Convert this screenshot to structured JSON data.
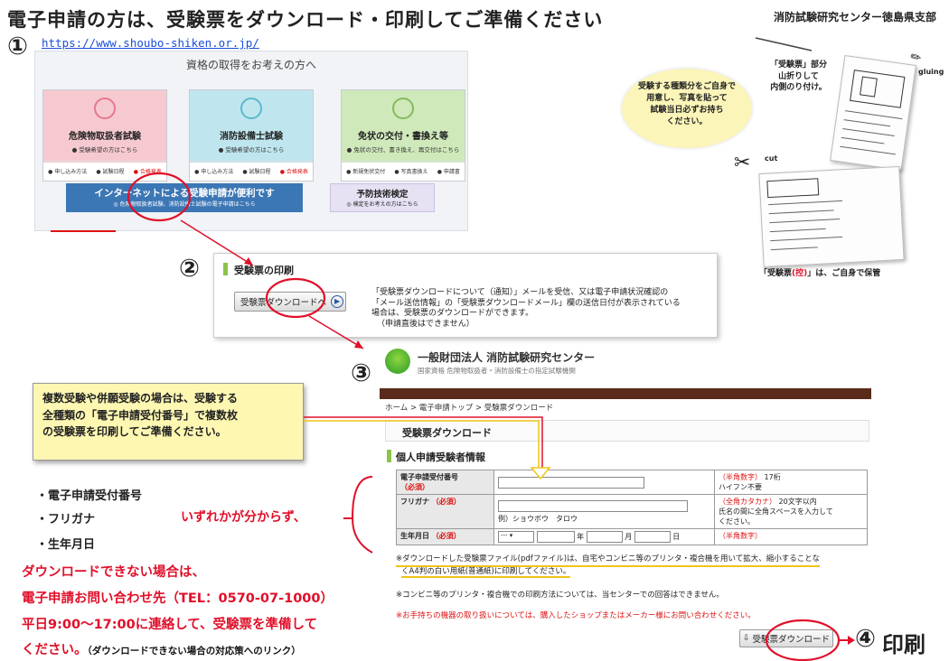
{
  "header": {
    "title": "電子申請の方は、受験票をダウンロード・印刷してご準備ください",
    "org": "消防試験研究センター徳島県支部"
  },
  "steps": {
    "one": "①",
    "two": "②",
    "three": "③",
    "four": "④",
    "print_label": "印刷"
  },
  "step1": {
    "url": "https://www.shoubo-shiken.or.jp/",
    "heading": "資格の取得をお考えの方へ",
    "cards": [
      {
        "title": "危険物取扱者試験",
        "sub": "● 受験希望の方はこちら",
        "links": [
          "● 申し込み方法",
          "● 試験日程",
          "● 合格発表"
        ],
        "color": "#f6c9d0",
        "icon_color": "#e35a7a"
      },
      {
        "title": "消防設備士試験",
        "sub": "● 受験希望の方はこちら",
        "links": [
          "● 申し込み方法",
          "● 試験日程",
          "● 合格発表"
        ],
        "color": "#bfe6ee",
        "icon_color": "#3aa9c4"
      },
      {
        "title": "免状の交付・書換え等",
        "sub": "● 免状の交付、書き換え、再交付はこちら",
        "links": [
          "● 新規免状交付",
          "● 写真書換え",
          "● 申請書"
        ],
        "color": "#cfe9bb",
        "icon_color": "#6aab3c"
      }
    ],
    "internet_title": "インターネットによる受験申請が便利です",
    "internet_sub": "◎ 危険物取扱者試験、消防設備士試験の電子申請はこちら",
    "yobo_title": "予防技術検定",
    "yobo_sub": "◎ 検定をお考えの方はこちら"
  },
  "step2": {
    "title": "受験票の印刷",
    "button": "受験票ダウンロードへ",
    "text": [
      "「受験票ダウンロードについて（通知）」メールを受信、又は電子申請状況確認の",
      "「メール送信情報」の「受験票ダウンロードメール」欄の送信日付が表示されている",
      "場合は、受験票のダウンロードができます。",
      "（申請直後はできません）"
    ]
  },
  "step3": {
    "org_name": "一般財団法人 消防試験研究センター",
    "org_sub": "国家資格 危険物取扱者・消防設備士の指定試験機関",
    "breadcrumb": "ホーム > 電子申請トップ > 受験票ダウンロード",
    "page_title": "受験票ダウンロード",
    "section_title": "個人申請受験者情報",
    "fields": [
      {
        "label": "電子申請受付番号",
        "required": "（必須）",
        "hint_red": "（半角数字）",
        "hint": "17桁",
        "hint2": "ハイフン不要"
      },
      {
        "label": "フリガナ",
        "required": "（必須）",
        "example": "例）ショウボウ　タロウ",
        "hint_red": "（全角カタカナ）",
        "hint": "20文字以内",
        "hint2": "氏名の間に全角スペースを入力して",
        "hint3": "ください。"
      },
      {
        "label": "生年月日",
        "required": "（必須）",
        "select": "---",
        "year": "年",
        "month": "月",
        "day": "日",
        "hint_red": "（半角数字）"
      }
    ],
    "note1_a": "※ダウンロードした受験票ファイル(pdfファイル)は、自宅やコンビニ等のプリンタ・複合機を用いて拡大、縮小することな",
    "note1_b": "くA4判の白い用紙(普通紙)に印刷してください。",
    "note2": "※コンビニ等のプリンタ・複合機での印刷方法については、当センターでの回答はできません。",
    "note3": "※お手持ちの機器の取り扱いについては、購入したショップまたはメーカー様にお問い合わせください。",
    "download_button": "受験票ダウンロード"
  },
  "left_notes": {
    "yellow": [
      "複数受験や併願受験の場合は、受験する",
      "全種類の「電子申請受付番号」で複数枚",
      "の受験票を印刷してご準備ください。"
    ],
    "items": [
      "・電子申請受付番号",
      "・フリガナ",
      "・生年月日"
    ],
    "unknown": "いずれかが分からず、",
    "red_lines": [
      "ダウンロードできない場合は、",
      "電子申請お問い合わせ先（TEL：0570-07-1000）",
      "平日9:00～17:00に連絡して、受験票を準備して",
      "ください。"
    ],
    "link": "（ダウンロードできない場合の対応策へのリンク）"
  },
  "right": {
    "bubble": [
      "受験する種類分をご自身で",
      "用意し、写真を貼って",
      "試験当日必ずお持ち",
      "ください。"
    ],
    "fold_note": [
      "「受験票」部分",
      "山折りして",
      "内側のり付け。"
    ],
    "gluing": "gluing",
    "cut": "cut",
    "stub_a": "「受験票",
    "stub_b": "(控)",
    "stub_c": "」は、ご自身で保管"
  }
}
